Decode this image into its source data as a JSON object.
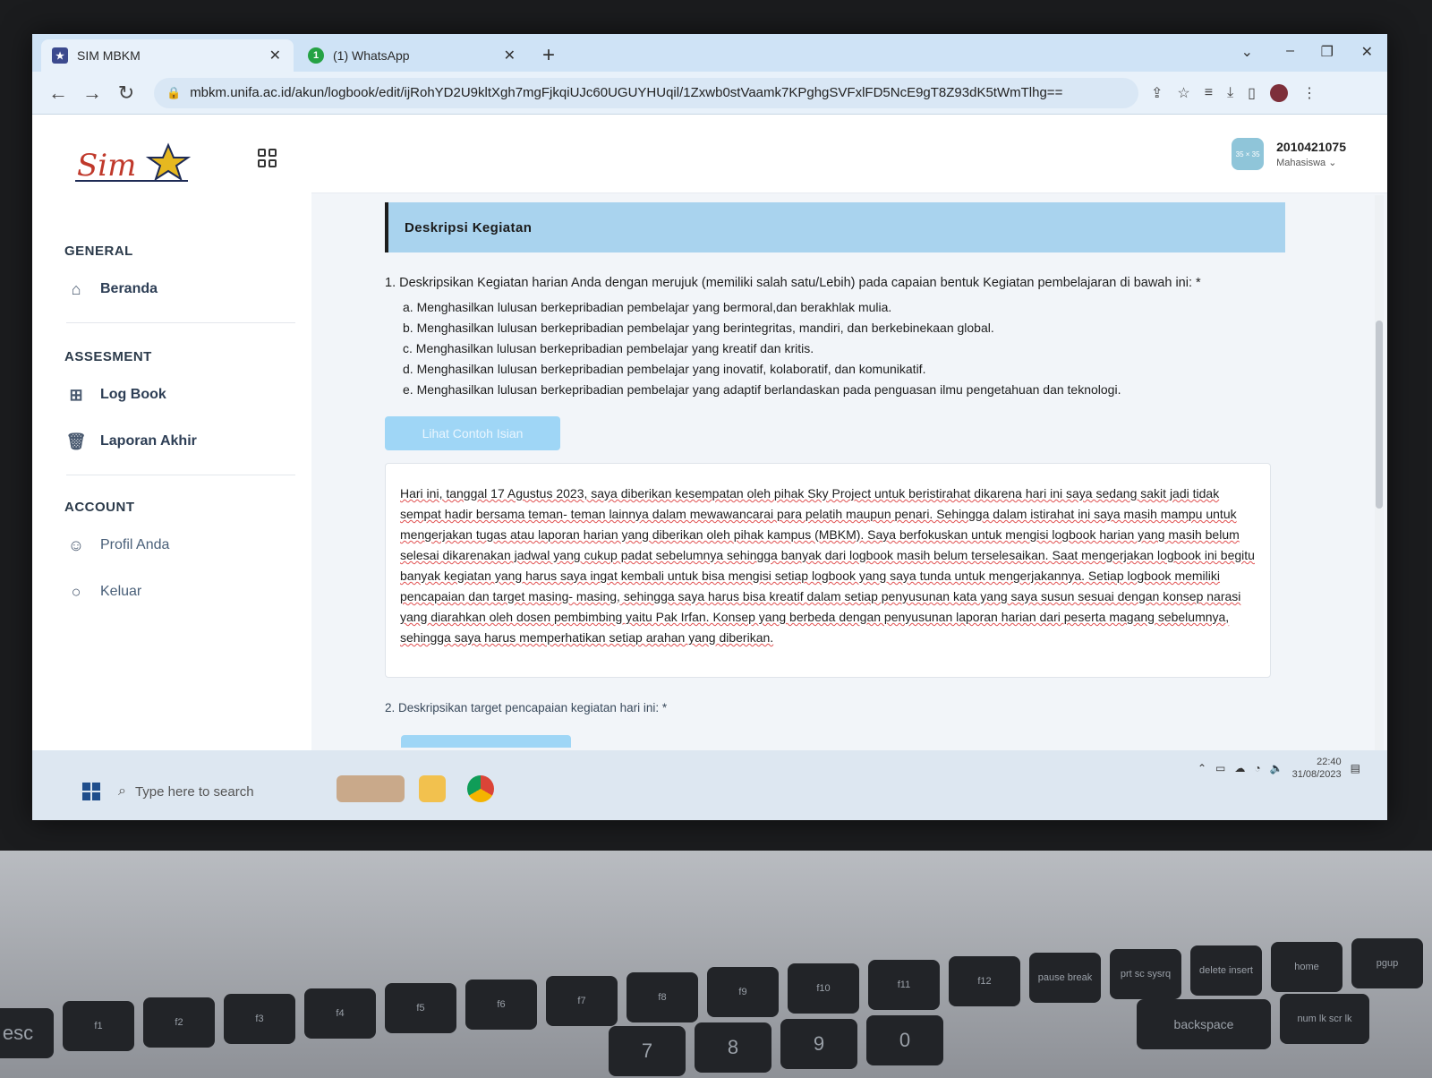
{
  "browser": {
    "tabs": [
      {
        "title": "SIM MBKM",
        "active": true
      },
      {
        "title": "(1) WhatsApp",
        "active": false,
        "badge": "1"
      }
    ],
    "close_glyph": "✕",
    "new_tab_glyph": "+",
    "url": "mbkm.unifa.ac.id/akun/logbook/edit/ijRohYD2U9kltXgh7mgFjkqiUJc60UGUYHUqil/1Zxwb0stVaamk7KPghgSVFxlFD5NcE9gT8Z93dK5tWmTlhg=="
  },
  "header": {
    "user_id": "2010421075",
    "user_role": "Mahasiswa ⌄",
    "avatar_text": "35 × 35"
  },
  "sidebar": {
    "logo_text": "Sim",
    "sections": {
      "general": "GENERAL",
      "assesment": "ASSESMENT",
      "account": "ACCOUNT"
    },
    "items": [
      {
        "label": "Beranda",
        "icon": "home-icon"
      },
      {
        "label": "Log Book",
        "icon": "logbook-icon"
      },
      {
        "label": "Laporan Akhir",
        "icon": "report-icon"
      },
      {
        "label": "Profil Anda",
        "icon": "profile-icon"
      },
      {
        "label": "Keluar",
        "icon": "logout-icon"
      }
    ]
  },
  "content": {
    "card_title": "Deskripsi Kegiatan",
    "question1": "1. Deskripsikan Kegiatan harian Anda dengan merujuk (memiliki salah satu/Lebih) pada capaian bentuk Kegiatan pembelajaran di bawah ini: *",
    "options": [
      "a. Menghasilkan lulusan berkepribadian pembelajar yang bermoral,dan berakhlak mulia.",
      "b. Menghasilkan lulusan berkepribadian pembelajar yang berintegritas, mandiri, dan berkebinekaan global.",
      "c. Menghasilkan lulusan berkepribadian pembelajar yang kreatif dan kritis.",
      "d. Menghasilkan lulusan berkepribadian pembelajar yang inovatif, kolaboratif, dan komunikatif.",
      "e. Menghasilkan lulusan berkepribadian pembelajar yang adaptif berlandaskan pada penguasan ilmu pengetahuan dan teknologi."
    ],
    "example_button": "Lihat Contoh Isian",
    "answer_text": "Hari ini, tanggal 17 Agustus 2023, saya diberikan kesempatan oleh pihak Sky Project untuk beristirahat dikarena hari ini saya sedang sakit jadi tidak sempat hadir bersama teman- teman lainnya dalam mewawancarai para pelatih maupun penari. Sehingga dalam istirahat ini saya masih mampu untuk mengerjakan tugas atau laporan harian yang diberikan oleh pihak kampus (MBKM). Saya berfokuskan untuk mengisi logbook harian yang masih belum selesai dikarenakan jadwal yang cukup padat sebelumnya sehingga banyak dari logbook masih belum terselesaikan. Saat mengerjakan logbook ini begitu banyak kegiatan yang harus saya ingat kembali untuk bisa mengisi setiap logbook yang saya tunda untuk mengerjakannya. Setiap logbook memiliki pencapaian dan target masing- masing, sehingga saya harus bisa kreatif dalam setiap penyusunan kata yang saya susun sesuai dengan konsep narasi yang diarahkan oleh dosen pembimbing yaitu Pak Irfan. Konsep yang berbeda dengan penyusunan laporan harian dari peserta magang sebelumnya, sehingga saya harus memperhatikan setiap arahan yang diberikan.",
    "question2": "2. Deskripsikan target pencapaian kegiatan hari ini: *"
  },
  "taskbar": {
    "search_placeholder": "Type here to search",
    "time": "22:40",
    "date": "31/08/2023"
  },
  "keyboard": {
    "keys": [
      "esc",
      "f1",
      "f2",
      "f3",
      "f4",
      "f5",
      "f6",
      "f7",
      "f8",
      "f9",
      "f10",
      "f11",
      "f12",
      "pause break",
      "prt sc sysrq",
      "delete insert",
      "home",
      "pgup",
      "7",
      "8",
      "9",
      "0",
      "backspace",
      "num lk scr lk"
    ]
  },
  "colors": {
    "accent": "#a9d3ee",
    "button": "#9fd6f6",
    "tabstrip": "#cfe3f6"
  }
}
